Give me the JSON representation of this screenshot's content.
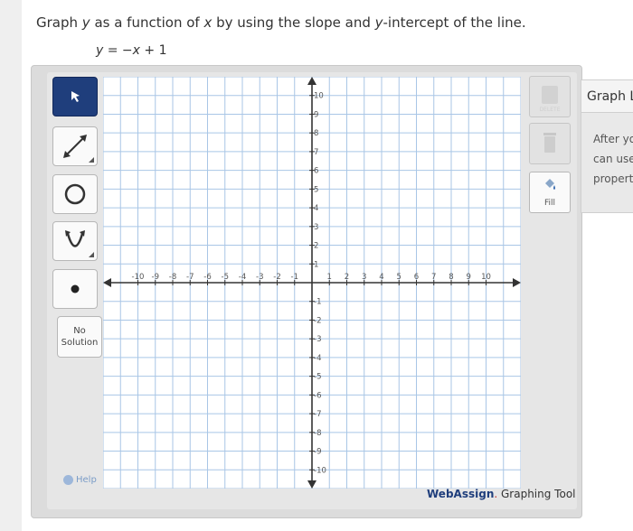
{
  "question": {
    "prompt_parts": [
      "Graph ",
      "y",
      " as a function of ",
      "x",
      " by using the slope and ",
      "y",
      "-intercept of the line."
    ],
    "equation_parts": [
      "y",
      " = −",
      "x",
      " + 1"
    ]
  },
  "tools": [
    {
      "name": "pointer-tool",
      "icon": "cursor-arrow-icon",
      "active": true
    },
    {
      "name": "line-tool",
      "icon": "line-icon",
      "active": false
    },
    {
      "name": "circle-tool",
      "icon": "circle-icon",
      "active": false
    },
    {
      "name": "parabola-tool",
      "icon": "parabola-icon",
      "active": false
    },
    {
      "name": "point-tool",
      "icon": "point-icon",
      "active": false
    }
  ],
  "no_solution": {
    "line1": "No",
    "line2": "Solution"
  },
  "help_label": "Help",
  "side_tools": {
    "delete_label": "DELETE",
    "fill_label": "Fill"
  },
  "brand": {
    "name": "WebAssign",
    "suffix": " Graphing Tool"
  },
  "right_panel": {
    "title": "Graph L",
    "lines": [
      "After yo",
      "can use",
      "propert"
    ]
  },
  "chart_data": {
    "type": "grid",
    "xlim": [
      -12,
      12
    ],
    "ylim": [
      -11,
      11
    ],
    "x_ticks": [
      -10,
      -9,
      -8,
      -7,
      -6,
      -5,
      -4,
      -3,
      -2,
      -1,
      1,
      2,
      3,
      4,
      5,
      6,
      7,
      8,
      9,
      10
    ],
    "y_ticks": [
      10,
      9,
      8,
      7,
      6,
      5,
      4,
      3,
      2,
      1,
      -1,
      -2,
      -3,
      -4,
      -5,
      -6,
      -7,
      -8,
      -9,
      -10
    ],
    "grid": true,
    "colors": {
      "grid": "#a9c6e6",
      "axis": "#333333",
      "background": "#ffffff"
    }
  }
}
